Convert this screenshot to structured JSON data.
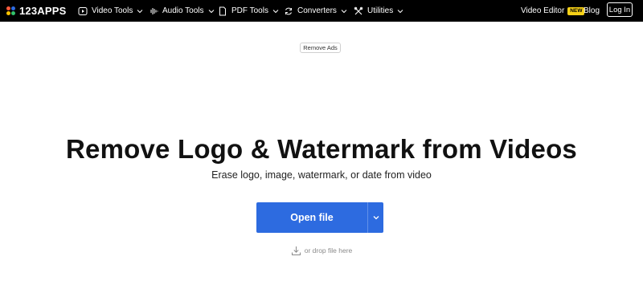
{
  "header": {
    "logo_text": "123APPS",
    "nav": [
      {
        "label": "Video Tools",
        "icon": "play-square-icon"
      },
      {
        "label": "Audio Tools",
        "icon": "audio-wave-icon"
      },
      {
        "label": "PDF Tools",
        "icon": "document-icon"
      },
      {
        "label": "Converters",
        "icon": "convert-arrows-icon"
      },
      {
        "label": "Utilities",
        "icon": "tools-icon"
      }
    ],
    "video_editor": "Video Editor",
    "new_badge": "NEW",
    "blog": "Blog",
    "login": "Log In"
  },
  "ads": {
    "remove_ads": "Remove Ads"
  },
  "main": {
    "title": "Remove Logo & Watermark from Videos",
    "subtitle": "Erase logo, image, watermark, or date from video",
    "open_file": "Open file",
    "drop_hint": "or drop file here"
  },
  "colors": {
    "header_bg": "#000000",
    "button_blue": "#2d6be0",
    "badge_yellow": "#f7d117",
    "logo_dots": [
      "#ff5a3c",
      "#2d6be0",
      "#ffc400",
      "#32c36c"
    ]
  }
}
